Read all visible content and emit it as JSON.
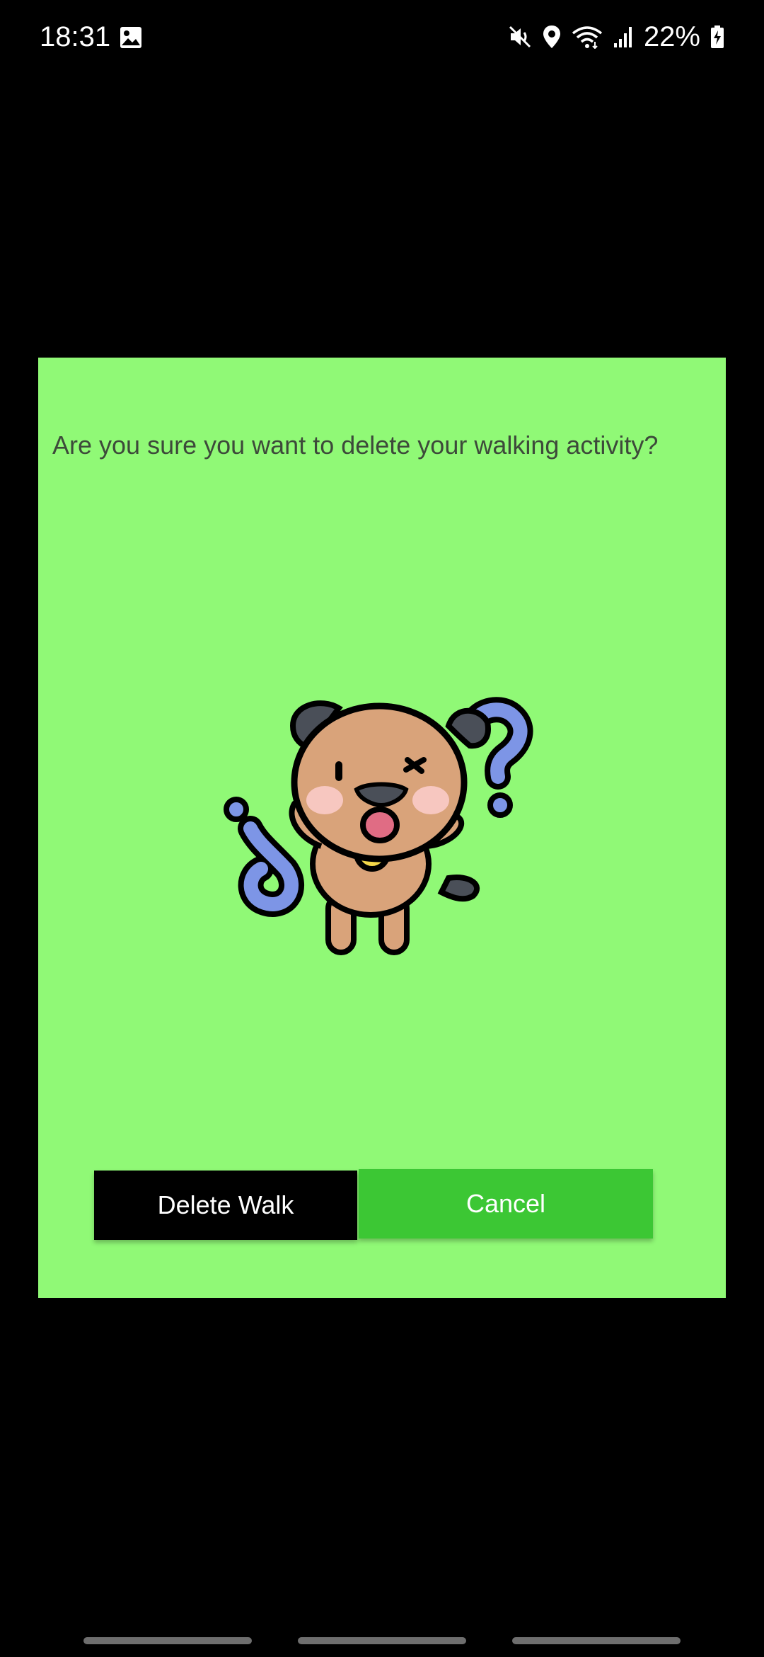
{
  "status_bar": {
    "time": "18:31",
    "battery_percent": "22%",
    "icons": [
      "gallery-icon",
      "mute-icon",
      "location-icon",
      "wifi-icon",
      "signal-icon",
      "battery-charging-icon"
    ]
  },
  "dialog": {
    "message": "Are you sure you want to delete your walking activity?",
    "illustration": "confused-dog-illustration",
    "delete_button_label": "Delete Walk",
    "cancel_button_label": "Cancel",
    "background_color": "#90f976",
    "cancel_color": "#3cc734",
    "delete_color": "#000000"
  },
  "navigation": {
    "items": [
      "recent-apps",
      "home",
      "back"
    ]
  }
}
